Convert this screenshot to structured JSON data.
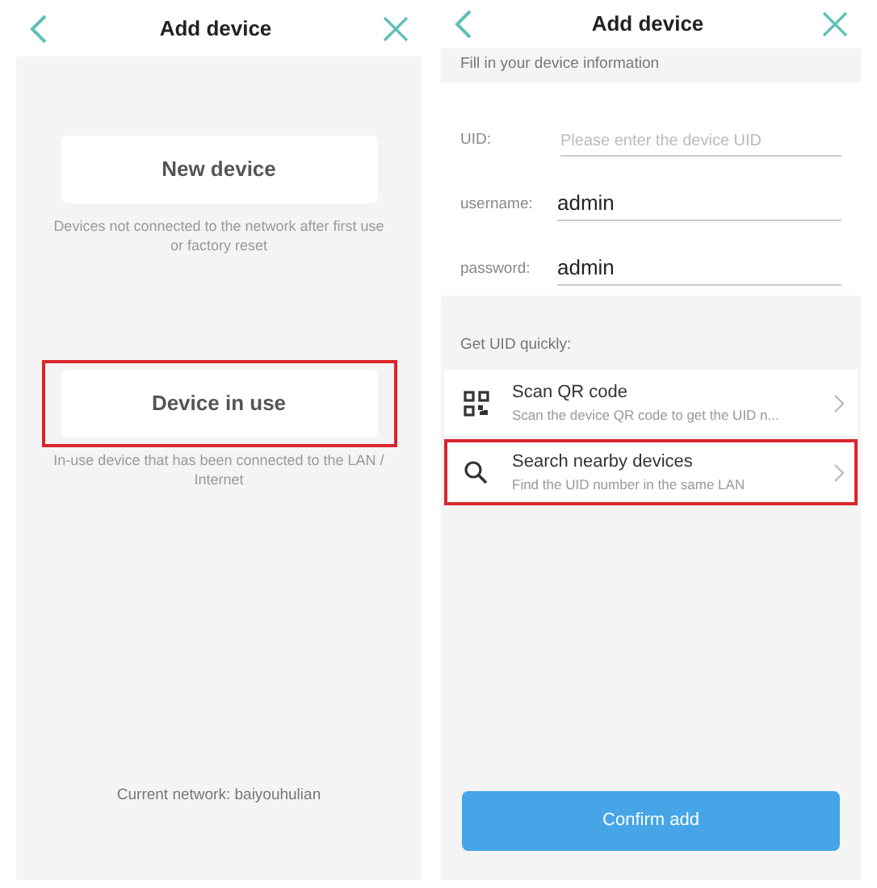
{
  "screens": [
    {
      "kind": "choose",
      "title": "Add device",
      "options": [
        {
          "label": "New device",
          "description": "Devices not connected to the network after first use or factory reset",
          "highlighted": false
        },
        {
          "label": "Device in use",
          "description": "In-use device that has been connected to the LAN / Internet",
          "highlighted": true
        }
      ],
      "footer": "Current network: baiyouhulian"
    },
    {
      "kind": "form",
      "title": "Add device",
      "section": "Fill in your device information",
      "fields": [
        {
          "label": "UID:",
          "placeholder": "Please enter the device UID"
        },
        {
          "label": "username:",
          "value": "admin"
        },
        {
          "label": "password:",
          "value": "admin"
        }
      ],
      "quick_title": "Get UID quickly:",
      "quick_rows": [
        {
          "kind": "qr",
          "title": "Scan QR code",
          "subtitle": "Scan the device QR code to get the UID n...",
          "highlighted": false
        },
        {
          "kind": "search",
          "title": "Search nearby devices",
          "subtitle": "Find the UID number in the same LAN",
          "highlighted": true
        }
      ],
      "button": "Confirm add"
    }
  ]
}
